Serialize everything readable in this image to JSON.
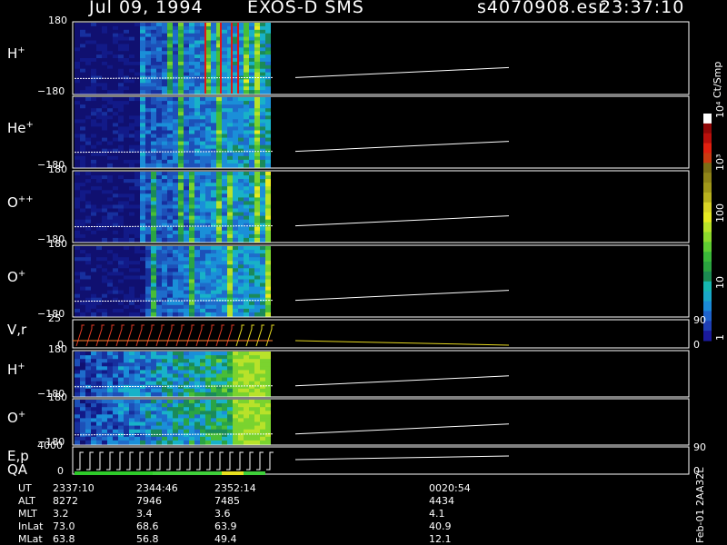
{
  "title": {
    "date": "Jul 09, 1994",
    "instrument": "EXOS-D SMS",
    "file": "s4070908.esr",
    "time": "23:37:10"
  },
  "chart_data": {
    "type": "heatmap",
    "panels": [
      {
        "label": "H",
        "sup": "+",
        "ytop": "180",
        "ybot": "−180",
        "right": ""
      },
      {
        "label": "He",
        "sup": "+",
        "ytop": "",
        "ybot": "−180",
        "right": ""
      },
      {
        "label": "O",
        "sup": "++",
        "ytop": "180",
        "ybot": "−180",
        "right": ""
      },
      {
        "label": "O",
        "sup": "+",
        "ytop": "180",
        "ybot": "−180",
        "right": ""
      },
      {
        "label": "V,r",
        "sup": "",
        "ytop": "25",
        "ybot": "0",
        "rtop": "90",
        "rbot": "0"
      },
      {
        "label": "H",
        "sup": "+",
        "ytop": "180",
        "ybot": "−180",
        "right": ""
      },
      {
        "label": "O",
        "sup": "+",
        "ytop": "180",
        "ybot": "−180",
        "right": ""
      },
      {
        "label": "E,p",
        "sup": "",
        "ytop": "4000",
        "ybot": "0",
        "rtop": "90",
        "rbot": "0",
        "label2": "QA"
      }
    ],
    "colorbar": {
      "unit": "Ct/Smp",
      "labels": [
        "1",
        "10",
        "100",
        "10³",
        "10⁴"
      ],
      "colors": [
        "#1a1a9c",
        "#1f3fb5",
        "#1e63cc",
        "#1b8ad8",
        "#1aa8c9",
        "#16b8b0",
        "#1c8a52",
        "#2ba340",
        "#3bb83a",
        "#5fcc33",
        "#8cd82d",
        "#b8e22a",
        "#e6ea21",
        "#d9d425",
        "#b8b11e",
        "#a1981a",
        "#8f8418",
        "#7a6e15",
        "#c93a10",
        "#e0200f",
        "#b8100c",
        "#900808",
        "#ffffff"
      ]
    },
    "table": {
      "rows": [
        "UT",
        "ALT",
        "MLT",
        "InLat",
        "MLat"
      ],
      "columns": [
        [
          "2337:10",
          "8272",
          "3.2",
          "73.0",
          "63.8"
        ],
        [
          "2344:46",
          "7946",
          "3.4",
          "68.6",
          "56.8"
        ],
        [
          "2352:14",
          "7485",
          "3.6",
          "63.9",
          "49.4"
        ],
        [
          "0020:54",
          "4434",
          "4.1",
          "40.9",
          "12.1"
        ]
      ]
    },
    "footer": "Feb-01 2AA32L"
  }
}
